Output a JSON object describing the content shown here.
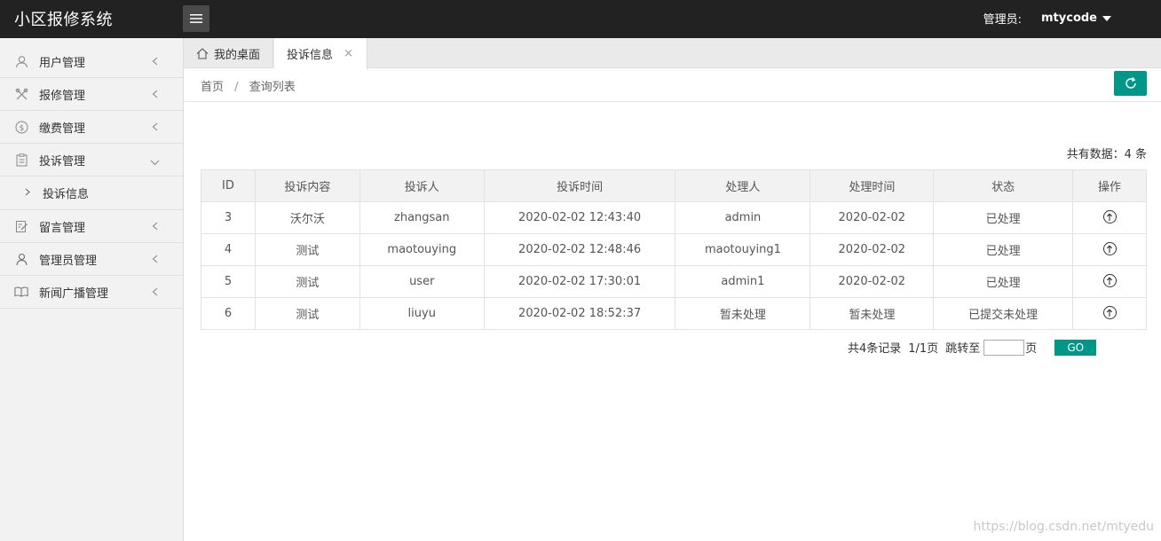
{
  "header": {
    "brand": "小区报修系统",
    "admin_label": "管理员:",
    "username": "mtycode"
  },
  "sidebar": {
    "items": [
      {
        "label": "用户管理",
        "icon": "user-icon"
      },
      {
        "label": "报修管理",
        "icon": "tools-icon"
      },
      {
        "label": "缴费管理",
        "icon": "dollar-icon"
      },
      {
        "label": "投诉管理",
        "icon": "clipboard-icon",
        "expanded": true
      },
      {
        "label": "留言管理",
        "icon": "note-edit-icon"
      },
      {
        "label": "管理员管理",
        "icon": "person-icon"
      },
      {
        "label": "新闻广播管理",
        "icon": "book-icon"
      }
    ],
    "sub_item": "投诉信息"
  },
  "tabs": {
    "home": "我的桌面",
    "active": "投诉信息",
    "close": "×"
  },
  "breadcrumb": {
    "home": "首页",
    "sep": "/",
    "current": "查询列表"
  },
  "total_text": "共有数据：4 条",
  "table": {
    "headers": [
      "ID",
      "投诉内容",
      "投诉人",
      "投诉时间",
      "处理人",
      "处理时间",
      "状态",
      "操作"
    ],
    "rows": [
      [
        "3",
        "沃尔沃",
        "zhangsan",
        "2020-02-02 12:43:40",
        "admin",
        "2020-02-02",
        "已处理"
      ],
      [
        "4",
        "测试",
        "maotouying",
        "2020-02-02 12:48:46",
        "maotouying1",
        "2020-02-02",
        "已处理"
      ],
      [
        "5",
        "测试",
        "user",
        "2020-02-02 17:30:01",
        "admin1",
        "2020-02-02",
        "已处理"
      ],
      [
        "6",
        "测试",
        "liuyu",
        "2020-02-02 18:52:37",
        "暂未处理",
        "暂未处理",
        "已提交未处理"
      ]
    ]
  },
  "pager": {
    "records": "共4条记录",
    "pages": "1/1页",
    "jump": "跳转至",
    "page_unit": "页",
    "go": "GO",
    "input_value": ""
  },
  "watermark": "https://blog.csdn.net/mtyedu",
  "colors": {
    "accent": "#009688",
    "header_bg": "#222222"
  }
}
